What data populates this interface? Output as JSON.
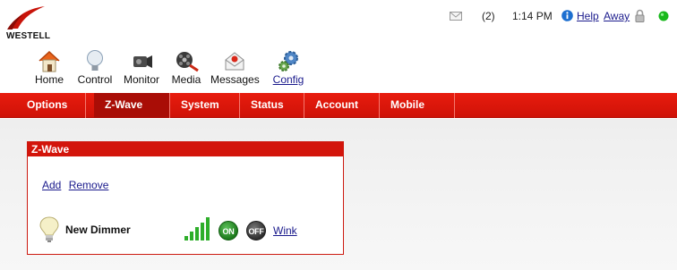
{
  "brand": {
    "logo_text": "WESTELL",
    "accent": "#d3150b"
  },
  "status": {
    "mail_icon": "envelope-icon",
    "message_count": "(2)",
    "time": "1:14 PM",
    "info_icon": "info-icon",
    "help": "Help",
    "mode": "Away",
    "lock_icon": "lock-icon",
    "indicator": "green-status-dot"
  },
  "main_nav": [
    {
      "label": "Home",
      "icon": "house-icon"
    },
    {
      "label": "Control",
      "icon": "lightbulb-icon"
    },
    {
      "label": "Monitor",
      "icon": "camera-icon"
    },
    {
      "label": "Media",
      "icon": "film-reel-icon"
    },
    {
      "label": "Messages",
      "icon": "envelope-icon"
    },
    {
      "label": "Config",
      "icon": "gears-icon",
      "active": true
    }
  ],
  "tabs": [
    {
      "label": "Options"
    },
    {
      "label": "Z-Wave",
      "active": true
    },
    {
      "label": "System"
    },
    {
      "label": "Status"
    },
    {
      "label": "Account"
    },
    {
      "label": "Mobile"
    }
  ],
  "panel": {
    "title": "Z-Wave",
    "actions": {
      "add": "Add",
      "remove": "Remove"
    },
    "devices": [
      {
        "name": "New Dimmer",
        "icon": "lightbulb-icon",
        "signal_icon": "signal-strength-icon",
        "on_label": "ON",
        "off_label": "OFF",
        "wink": "Wink"
      }
    ]
  }
}
